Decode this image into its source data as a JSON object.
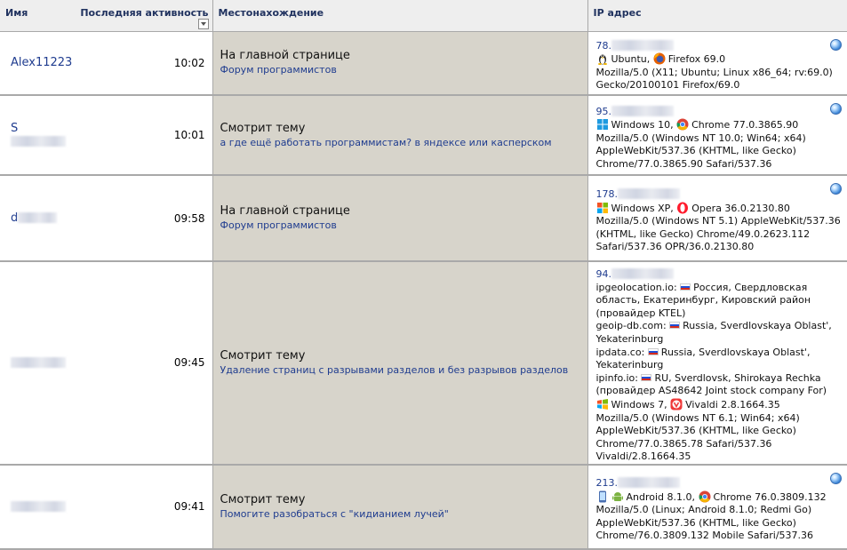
{
  "header": {
    "col_name": "Имя",
    "col_activity": "Последняя активность",
    "col_location": "Местонахождение",
    "col_ip": "IP адрес"
  },
  "rows": [
    {
      "name": "Alex11223",
      "time": "10:02",
      "loc_title": "На главной странице",
      "loc_link": "Форум программистов",
      "ip_prefix": "78.",
      "os_icon": "linux-icon",
      "os": "Ubuntu,",
      "browser_icon": "firefox-icon",
      "browser": "Firefox 69.0",
      "ua": "Mozilla/5.0 (X11; Ubuntu; Linux x86_64; rv:69.0) Gecko/20100101 Firefox/69.0"
    },
    {
      "name": "S",
      "time": "10:01",
      "loc_title": "Смотрит тему",
      "loc_link": "а где ещё работать программистам? в яндексе или касперском",
      "ip_prefix": "95.",
      "os_icon": "windows-icon",
      "os": "Windows 10,",
      "browser_icon": "chrome-icon",
      "browser": "Chrome 77.0.3865.90",
      "ua": "Mozilla/5.0 (Windows NT 10.0; Win64; x64) AppleWebKit/537.36 (KHTML, like Gecko) Chrome/77.0.3865.90 Safari/537.36"
    },
    {
      "name": "d",
      "time": "09:58",
      "loc_title": "На главной странице",
      "loc_link": "Форум программистов",
      "ip_prefix": "178.",
      "os_icon": "windows-xp-icon",
      "os": "Windows XP,",
      "browser_icon": "opera-icon",
      "browser": "Opera 36.0.2130.80",
      "ua": "Mozilla/5.0 (Windows NT 5.1) AppleWebKit/537.36 (KHTML, like Gecko) Chrome/49.0.2623.112 Safari/537.36 OPR/36.0.2130.80"
    },
    {
      "name": "",
      "time": "09:45",
      "loc_title": "Смотрит тему",
      "loc_link": "Удаление страниц с разрывами разделов и без разрывов разделов",
      "ip_prefix": "94.",
      "geo": [
        {
          "label": "ipgeolocation.io:",
          "text": "Россия, Свердловская область, Екатеринбург, Кировский район (провайдер KTEL)"
        },
        {
          "label": "geoip-db.com:",
          "text": "Russia, Sverdlovskaya Oblast', Yekaterinburg"
        },
        {
          "label": "ipdata.co:",
          "text": "Russia, Sverdlovskaya Oblast', Yekaterinburg"
        },
        {
          "label": "ipinfo.io:",
          "text": "RU, Sverdlovsk, Shirokaya Rechka (провайдер AS48642 Joint stock company For)"
        }
      ],
      "os_icon": "windows-icon",
      "os": "Windows 7,",
      "browser_icon": "vivaldi-icon",
      "browser": "Vivaldi 2.8.1664.35",
      "ua": "Mozilla/5.0 (Windows NT 6.1; Win64; x64) AppleWebKit/537.36 (KHTML, like Gecko) Chrome/77.0.3865.78 Safari/537.36 Vivaldi/2.8.1664.35"
    },
    {
      "name": "",
      "time": "09:41",
      "loc_title": "Смотрит тему",
      "loc_link": "Помогите разобраться с \"кидианием лучей\"",
      "ip_prefix": "213.",
      "os_icon": "android-icon",
      "os": "Android 8.1.0,",
      "browser_icon": "chrome-icon",
      "browser": "Chrome 76.0.3809.132",
      "ua": "Mozilla/5.0 (Linux; Android 8.1.0; Redmi Go) AppleWebKit/537.36 (KHTML, like Gecko) Chrome/76.0.3809.132 Mobile Safari/537.36"
    }
  ]
}
